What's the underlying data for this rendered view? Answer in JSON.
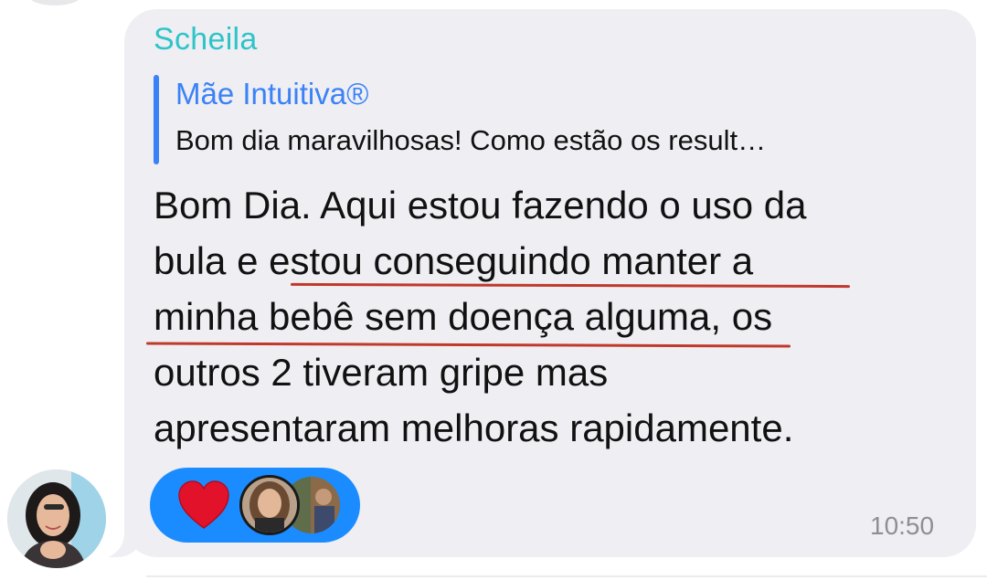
{
  "chat": {
    "sender_name": "Scheila",
    "reply": {
      "author": "Mãe Intuitiva®",
      "snippet": "Bom dia maravilhosas! Como estão os result…"
    },
    "message_lines": [
      "Bom Dia. Aqui estou fazendo o uso da",
      "bula e estou conseguindo manter a",
      "minha bebê sem doença alguma, os",
      "outros 2 tiveram gripe mas",
      "apresentaram melhoras rapidamente."
    ],
    "time": "10:50",
    "reactions": {
      "emoji": "heart-icon",
      "reactor_count": 2
    }
  },
  "colors": {
    "bubble_background": "#eeeef3",
    "sender_name": "#2ec4c9",
    "reply_accent": "#3b82f6",
    "reaction_pill": "#1a8cff",
    "highlight_underline": "#c0392b",
    "timestamp": "#8e8e93"
  }
}
